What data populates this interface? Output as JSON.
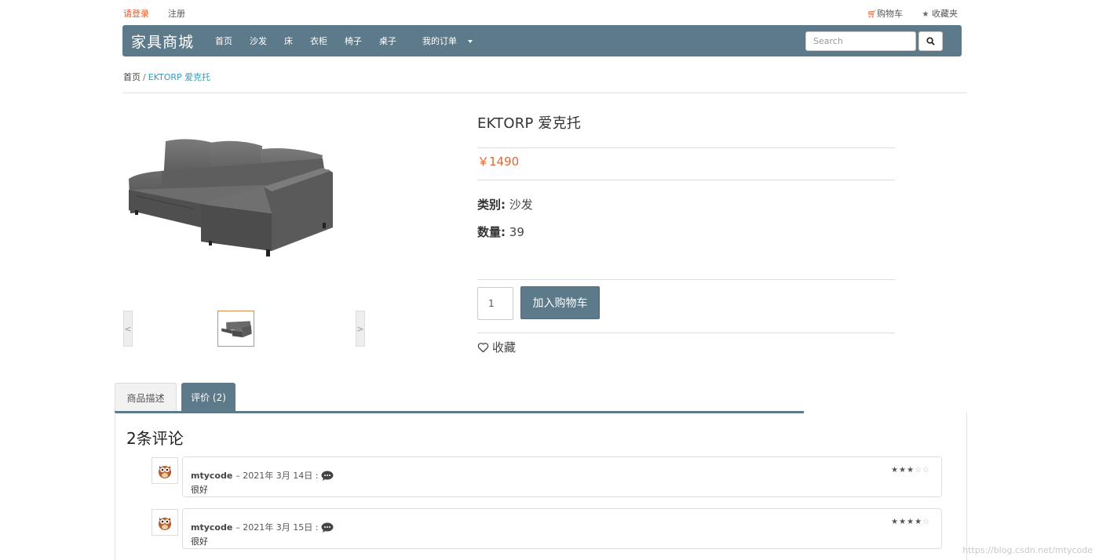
{
  "top_links": {
    "login": "请登录",
    "register": "注册",
    "cart": "购物车",
    "favorites": "收藏夹"
  },
  "navbar": {
    "brand": "家具商城",
    "items": [
      "首页",
      "沙发",
      "床",
      "衣柜",
      "椅子",
      "桌子",
      "我的订单"
    ],
    "search_placeholder": "Search",
    "accent_color": "#5d7a8a"
  },
  "breadcrumb": {
    "home": "首页",
    "separator": "/",
    "current": "EKTORP 爱克托"
  },
  "gallery": {
    "prev": "<",
    "next": ">"
  },
  "product": {
    "title": "EKTORP 爱克托",
    "price": "￥1490",
    "category_label": "类别:",
    "category_value": "沙发",
    "quantity_label": "数量:",
    "quantity_value": "39",
    "qty_input": "1",
    "add_to_cart": "加入购物车",
    "favorite": "收藏",
    "price_color": "#e0672f"
  },
  "tabs": {
    "description": "商品描述",
    "reviews": "评价 (2)"
  },
  "reviews": {
    "heading": "2条评论",
    "items": [
      {
        "author": "mtycode",
        "date": "– 2021年 3月 14日 :",
        "text": "很好",
        "rating": 3,
        "max": 5
      },
      {
        "author": "mtycode",
        "date": "– 2021年 3月 15日 :",
        "text": "很好",
        "rating": 4,
        "max": 5
      }
    ]
  },
  "watermark": "https://blog.csdn.net/mtycode"
}
